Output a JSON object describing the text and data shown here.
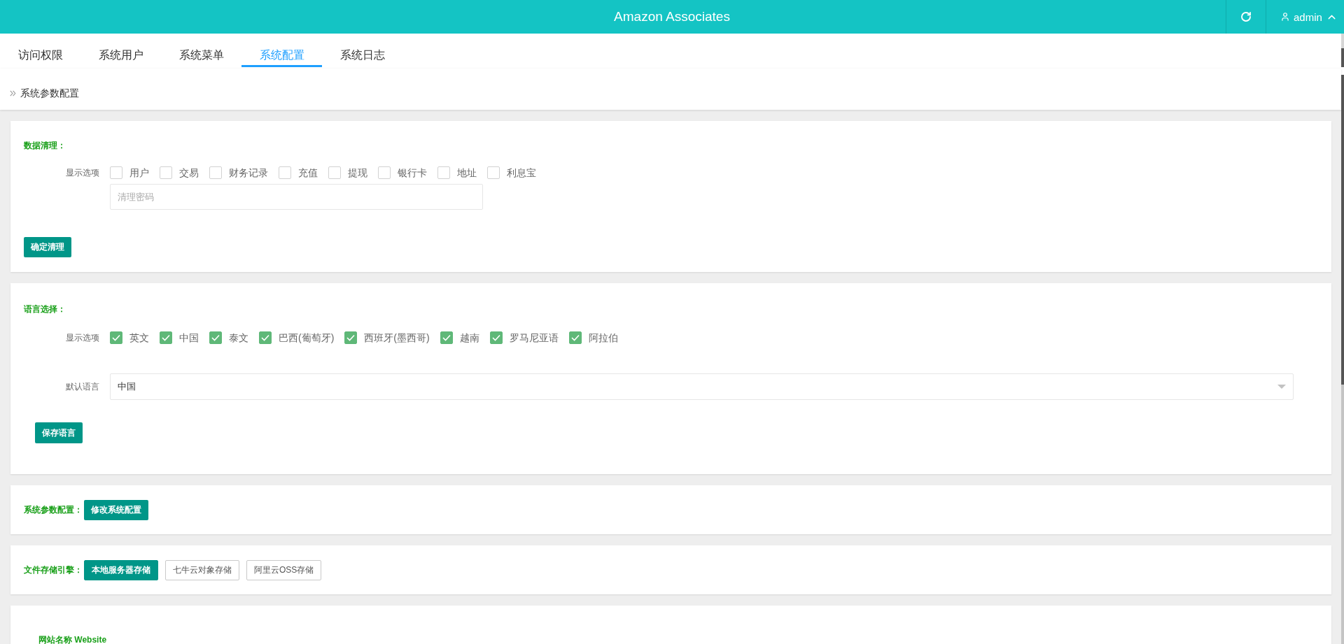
{
  "header": {
    "title": "Amazon Associates",
    "user": "admin"
  },
  "tabs": [
    {
      "label": "访问权限",
      "selected": false
    },
    {
      "label": "系统用户",
      "selected": false
    },
    {
      "label": "系统菜单",
      "selected": false
    },
    {
      "label": "系统配置",
      "selected": true
    },
    {
      "label": "系统日志",
      "selected": false
    }
  ],
  "breadcrumb": [
    "系统参数配置"
  ],
  "data_cleanup": {
    "title": "数据清理：",
    "options_label": "显示选项",
    "options": [
      {
        "label": "用户",
        "checked": false
      },
      {
        "label": "交易",
        "checked": false
      },
      {
        "label": "财务记录",
        "checked": false
      },
      {
        "label": "充值",
        "checked": false
      },
      {
        "label": "提现",
        "checked": false
      },
      {
        "label": "银行卡",
        "checked": false
      },
      {
        "label": "地址",
        "checked": false
      },
      {
        "label": "利息宝",
        "checked": false
      }
    ],
    "password": {
      "placeholder": "清理密码"
    },
    "button": "确定清理"
  },
  "language": {
    "title": "语言选择：",
    "options_label": "显示选项",
    "options": [
      {
        "label": "英文",
        "checked": true
      },
      {
        "label": "中国",
        "checked": true
      },
      {
        "label": "泰文",
        "checked": true
      },
      {
        "label": "巴西(葡萄牙)",
        "checked": true
      },
      {
        "label": "西班牙(墨西哥)",
        "checked": true
      },
      {
        "label": "越南",
        "checked": true
      },
      {
        "label": "罗马尼亚语",
        "checked": true
      },
      {
        "label": "阿拉伯",
        "checked": true
      }
    ],
    "default_label": "默认语言",
    "default_select": {
      "value": "中国"
    },
    "button": "保存语言"
  },
  "system_params": {
    "title": "系统参数配置：",
    "button": "修改系统配置"
  },
  "file_storage": {
    "title": "文件存储引擎：",
    "options": [
      {
        "label": "本地服务器存储",
        "selected": true
      },
      {
        "label": "七牛云对象存储",
        "selected": false
      },
      {
        "label": "阿里云OSS存储",
        "selected": false
      }
    ]
  },
  "website": {
    "title": "网站名称 Website"
  }
}
